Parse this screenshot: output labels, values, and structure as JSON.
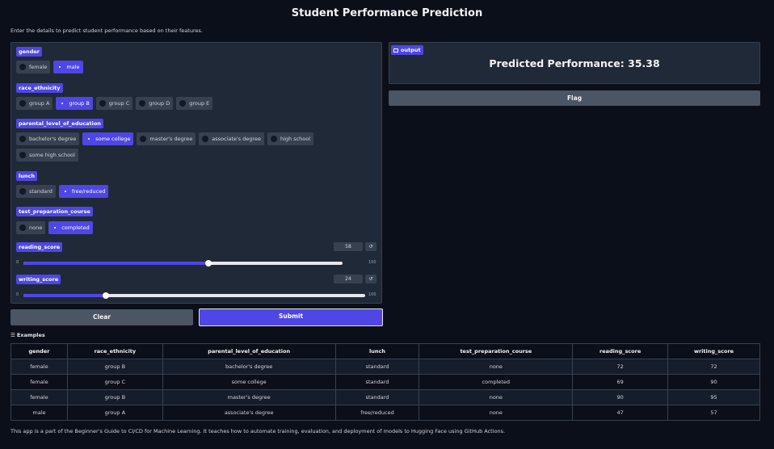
{
  "page": {
    "title": "Student Performance Prediction",
    "description": "Enter the details to predict student performance based on their features."
  },
  "form": {
    "gender": {
      "label": "gender",
      "options": [
        "female",
        "male"
      ],
      "selected": "male"
    },
    "race_ethnicity": {
      "label": "race_ethnicity",
      "options": [
        "group A",
        "group B",
        "group C",
        "group D",
        "group E"
      ],
      "selected": "group B"
    },
    "parental_level_of_education": {
      "label": "parental_level_of_education",
      "options_row1": [
        "bachelor's degree",
        "some college",
        "master's degree",
        "associate's degree",
        "high school"
      ],
      "options_row2": [
        "some high school"
      ],
      "selected": "some college"
    },
    "lunch": {
      "label": "lunch",
      "options": [
        "standard",
        "free/reduced"
      ],
      "selected": "free/reduced"
    },
    "test_preparation_course": {
      "label": "test_preparation_course",
      "options": [
        "none",
        "completed"
      ],
      "selected": "completed"
    },
    "reading_score": {
      "label": "reading_score",
      "value": "58",
      "value_num": 58,
      "min": "0",
      "max": "100",
      "reset_icon": "↺"
    },
    "writing_score": {
      "label": "writing_score",
      "value": "24",
      "value_num": 24,
      "min": "0",
      "max": "100",
      "reset_icon": "↺"
    }
  },
  "actions": {
    "clear_label": "Clear",
    "submit_label": "Submit",
    "flag_label": "Flag"
  },
  "output": {
    "label": "output",
    "icon": "output-icon",
    "text": "Predicted Performance: 35.38"
  },
  "examples": {
    "title": "Examples",
    "icon": "list-icon",
    "columns": [
      "gender",
      "race_ethnicity",
      "parental_level_of_education",
      "lunch",
      "test_preparation_course",
      "reading_score",
      "writing_score"
    ],
    "rows": [
      [
        "female",
        "group B",
        "bachelor's degree",
        "standard",
        "none",
        "72",
        "72"
      ],
      [
        "female",
        "group C",
        "some college",
        "standard",
        "completed",
        "69",
        "90"
      ],
      [
        "female",
        "group B",
        "master's degree",
        "standard",
        "none",
        "90",
        "95"
      ],
      [
        "male",
        "group A",
        "associate's degree",
        "free/reduced",
        "none",
        "47",
        "57"
      ]
    ]
  },
  "footer": {
    "text": "This app is a part of the Beginner's Guide to CI/CD for Machine Learning. It teaches how to automate training, evaluation, and deployment of models to Hugging Face using GitHub Actions."
  }
}
